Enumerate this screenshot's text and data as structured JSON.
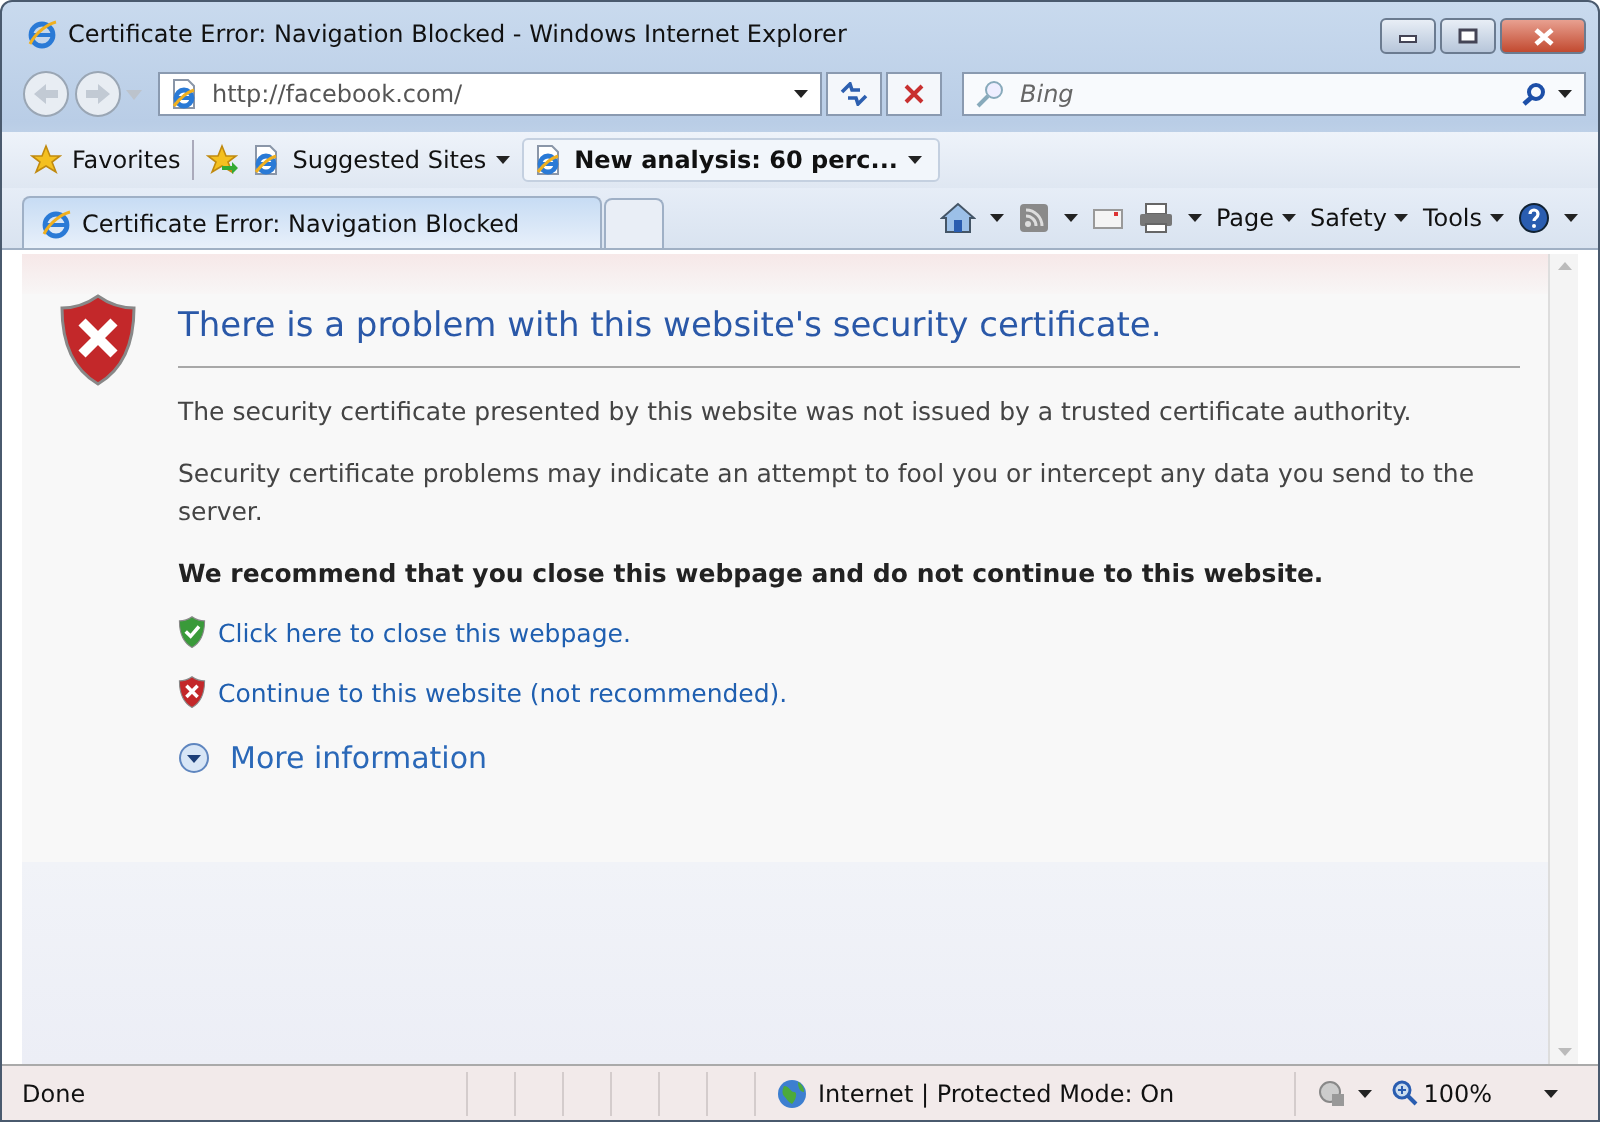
{
  "window": {
    "title": "Certificate Error: Navigation Blocked - Windows Internet Explorer"
  },
  "address_bar": {
    "url": "http://facebook.com/"
  },
  "search": {
    "placeholder": "Bing"
  },
  "favorites_bar": {
    "favorites": "Favorites",
    "items": [
      {
        "label": "Suggested Sites",
        "kind": "menu"
      },
      {
        "label": "New analysis: 60 perc...",
        "kind": "feed"
      }
    ]
  },
  "tabs": [
    {
      "label": "Certificate Error: Navigation Blocked",
      "selected": true
    }
  ],
  "command_bar": {
    "menus": [
      "Page",
      "Safety",
      "Tools"
    ]
  },
  "content": {
    "heading": "There is a problem with this website's security certificate.",
    "paragraphs": [
      "The security certificate presented by this website was not issued by a trusted certificate authority.",
      "Security certificate problems may indicate an attempt to fool you or intercept any data you send to the server."
    ],
    "recommendation": "We recommend that you close this webpage and do not continue to this website.",
    "links": [
      {
        "label": "Click here to close this webpage.",
        "kind": "safe"
      },
      {
        "label": "Continue to this website (not recommended).",
        "kind": "unsafe"
      }
    ],
    "more_info": "More information"
  },
  "status_bar": {
    "text": "Done",
    "zone": "Internet | Protected Mode: On",
    "zoom": "100%"
  }
}
